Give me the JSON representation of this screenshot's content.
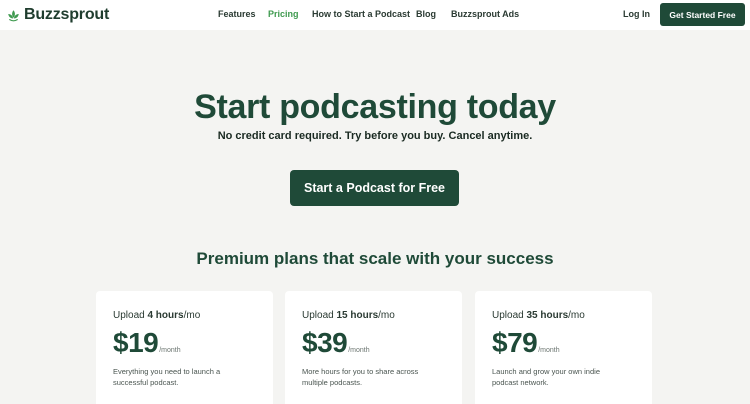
{
  "brand": {
    "name": "Buzzsprout",
    "logo_color": "#3f9a4f",
    "primary_color": "#1f4a38"
  },
  "nav": {
    "items": [
      {
        "label": "Features"
      },
      {
        "label": "Pricing",
        "active": true
      },
      {
        "label": "How to Start a Podcast"
      },
      {
        "label": "Blog"
      },
      {
        "label": "Buzzsprout Ads"
      }
    ],
    "login_label": "Log In",
    "cta_label": "Get Started Free"
  },
  "hero": {
    "title": "Start podcasting today",
    "subtitle": "No credit card required. Try before you buy. Cancel anytime.",
    "button_label": "Start a Podcast for Free"
  },
  "plans": {
    "heading": "Premium plans that scale with your success",
    "items": [
      {
        "upload_prefix": "Upload ",
        "upload_hours": "4 hours",
        "upload_suffix": "/mo",
        "price": "$19",
        "per": "/month",
        "description": "Everything you need to launch a successful podcast."
      },
      {
        "upload_prefix": "Upload ",
        "upload_hours": "15 hours",
        "upload_suffix": "/mo",
        "price": "$39",
        "per": "/month",
        "description": "More hours for you to share across multiple podcasts."
      },
      {
        "upload_prefix": "Upload ",
        "upload_hours": "35 hours",
        "upload_suffix": "/mo",
        "price": "$79",
        "per": "/month",
        "description": "Launch and grow your own indie podcast network."
      }
    ]
  }
}
